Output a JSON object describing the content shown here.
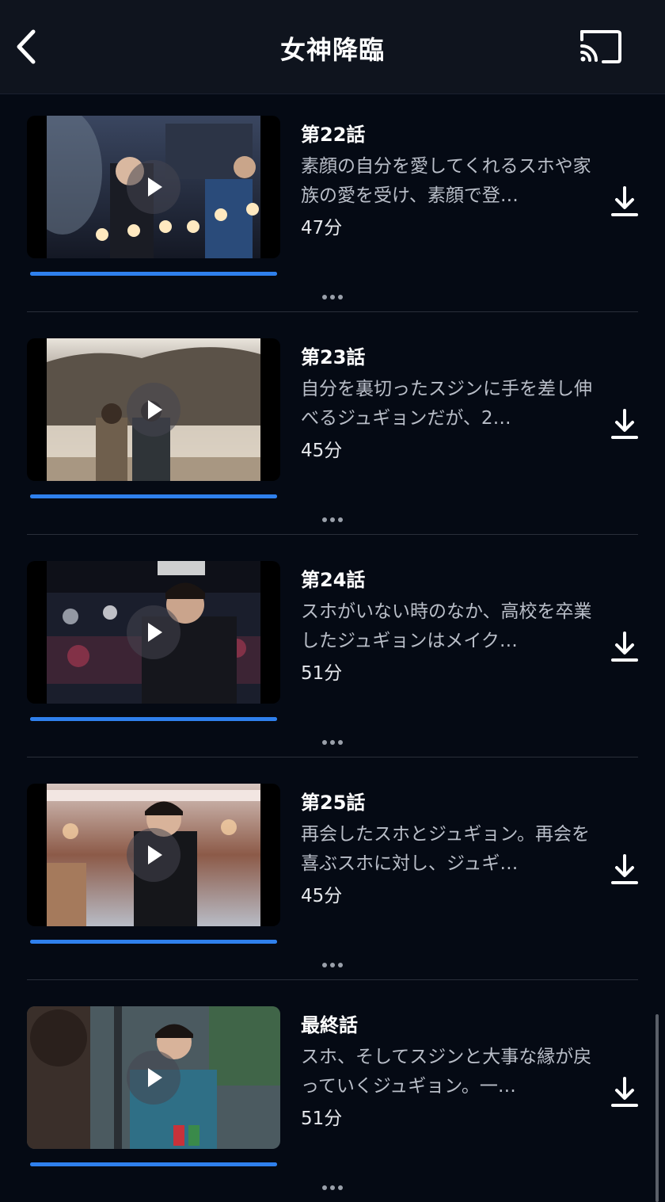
{
  "header": {
    "title": "女神降臨",
    "back_icon": "chevron-left-icon",
    "cast_icon": "cast-icon"
  },
  "episodes": [
    {
      "title": "第22話",
      "description": "素顔の自分を愛してくれるスホや家族の愛を受け、素顔で登…",
      "duration": "47分",
      "progress": 1.0
    },
    {
      "title": "第23話",
      "description": "自分を裏切ったスジンに手を差し伸べるジュギョンだが、2…",
      "duration": "45分",
      "progress": 1.0
    },
    {
      "title": "第24話",
      "description": "スホがいない時のなか、高校を卒業したジュギョンはメイク…",
      "duration": "51分",
      "progress": 1.0
    },
    {
      "title": "第25話",
      "description": "再会したスホとジュギョン。再会を喜ぶスホに対し、ジュギ…",
      "duration": "45分",
      "progress": 1.0
    },
    {
      "title": "最終話",
      "description": "スホ、そしてスジンと大事な縁が戻っていくジュギョン。一…",
      "duration": "51分",
      "progress": 1.0
    }
  ],
  "colors": {
    "background": "#050a14",
    "header_bg": "#0f141e",
    "progress": "#2f80ed",
    "description": "#b9bec8"
  }
}
